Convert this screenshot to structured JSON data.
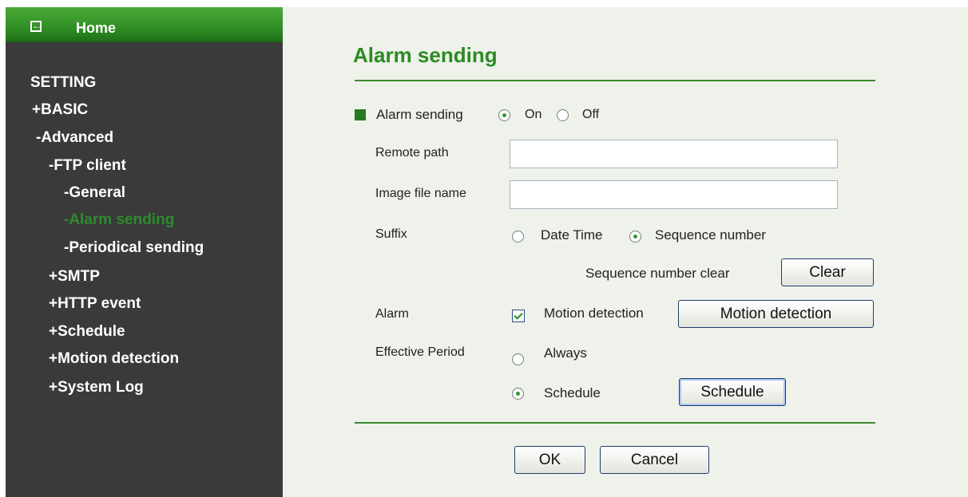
{
  "sidebar": {
    "home_label": "Home",
    "setting": "SETTING",
    "basic": "+BASIC",
    "advanced": "-Advanced",
    "ftp_client": "-FTP client",
    "general": "-General",
    "alarm_sending": "-Alarm sending",
    "periodical_sending": "-Periodical sending",
    "smtp": "+SMTP",
    "http_event": "+HTTP event",
    "schedule": "+Schedule",
    "motion_detection": "+Motion detection",
    "system_log": "+System Log"
  },
  "main": {
    "title": "Alarm sending",
    "alarm_sending_label": "Alarm sending",
    "on_label": "On",
    "off_label": "Off",
    "alarm_sending_value": "On",
    "remote_path_label": "Remote path",
    "remote_path_value": "",
    "image_file_name_label": "Image file name",
    "image_file_name_value": "",
    "suffix_label": "Suffix",
    "suffix_options": [
      "Date Time",
      "Sequence number"
    ],
    "suffix_value": "Sequence number",
    "sequence_clear_label": "Sequence number clear",
    "clear_button": "Clear",
    "alarm_label": "Alarm",
    "motion_detection_checkbox_label": "Motion detection",
    "motion_detection_checked": true,
    "motion_detection_button": "Motion detection",
    "effective_period_label": "Effective Period",
    "always_label": "Always",
    "schedule_label": "Schedule",
    "effective_period_value": "Schedule",
    "schedule_button": "Schedule",
    "ok_button": "OK",
    "cancel_button": "Cancel"
  },
  "colors": {
    "sidebar_bg": "#3a3a3a",
    "home_bar": "#2f8f24",
    "accent_green": "#2c8a22",
    "main_bg": "#eef2ea"
  }
}
